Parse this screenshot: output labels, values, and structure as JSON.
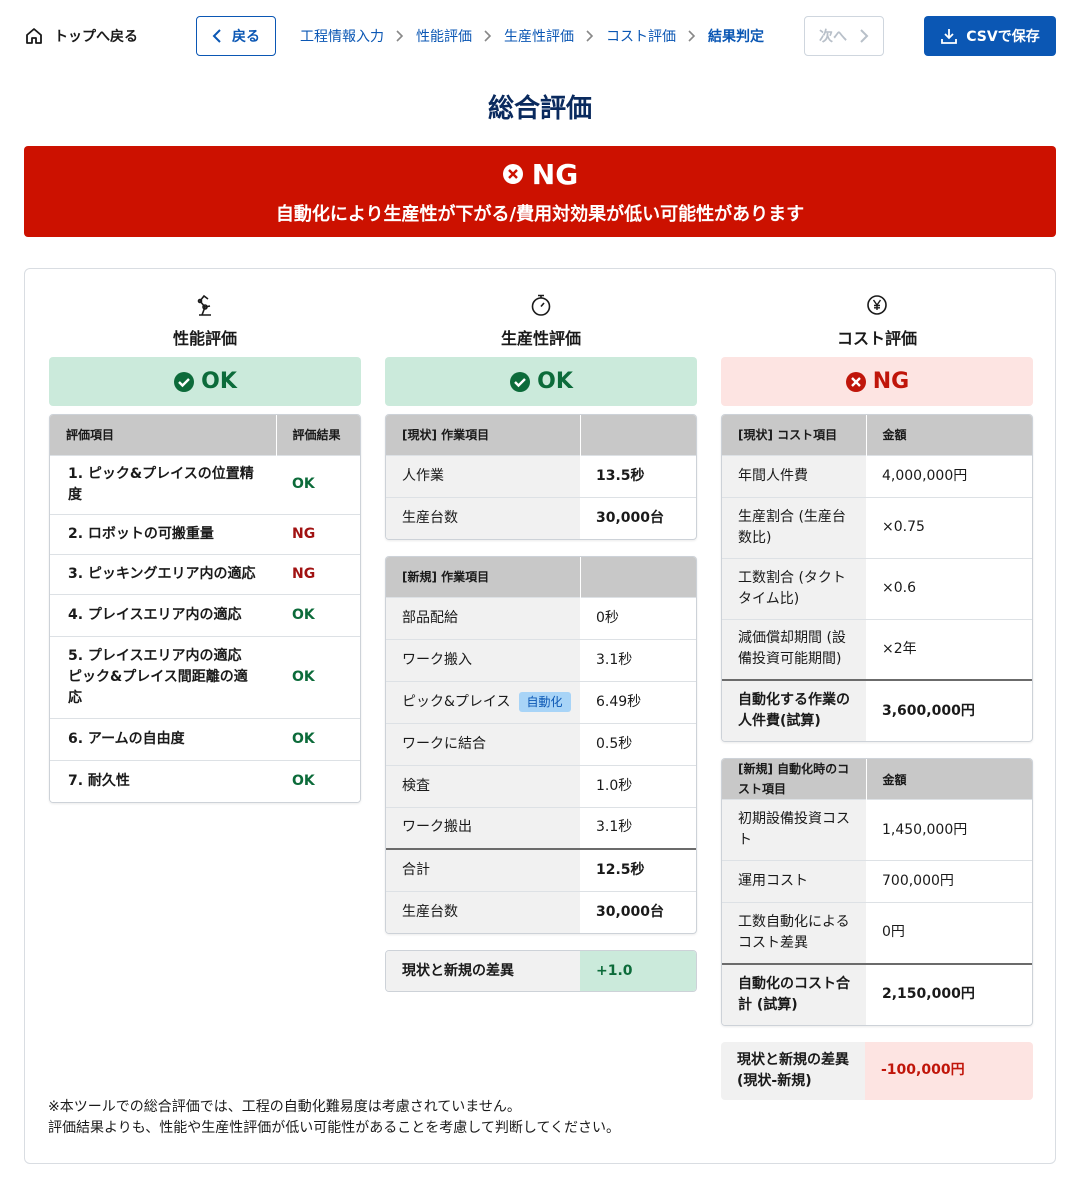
{
  "header": {
    "home_label": "トップへ戻る",
    "back_label": "戻る",
    "next_label": "次へ",
    "csv_label": "CSVで保存",
    "breadcrumbs": [
      "工程情報入力",
      "性能評価",
      "生産性評価",
      "コスト評価",
      "結果判定"
    ]
  },
  "page_title": "総合評価",
  "overall": {
    "status": "NG",
    "message": "自動化により生産性が下がる/費用対効果が低い可能性があります",
    "color": "#cc1100"
  },
  "performance": {
    "title": "性能評価",
    "icon": "robot-arm-icon",
    "result": "OK",
    "headers": [
      "評価項目",
      "評価結果"
    ],
    "rows": [
      {
        "item": "1. ピック&プレイスの位置精度",
        "result": "OK"
      },
      {
        "item": "2. ロボットの可搬重量",
        "result": "NG"
      },
      {
        "item": "3. ピッキングエリア内の適応",
        "result": "NG"
      },
      {
        "item": "4. プレイスエリア内の適応",
        "result": "OK"
      },
      {
        "item": "5. プレイスエリア内の適応 ピック&プレイス間距離の適応",
        "result": "OK"
      },
      {
        "item": "6. アームの自由度",
        "result": "OK"
      },
      {
        "item": "7. 耐久性",
        "result": "OK"
      }
    ]
  },
  "productivity": {
    "title": "生産性評価",
    "icon": "stopwatch-icon",
    "result": "OK",
    "current": {
      "header": "[現状] 作業項目",
      "rows": [
        {
          "label": "人作業",
          "value": "13.5秒"
        },
        {
          "label": "生産台数",
          "value": "30,000台"
        }
      ]
    },
    "new": {
      "header": "[新規] 作業項目",
      "tag": "自動化",
      "rows": [
        {
          "label": "部品配給",
          "value": "0秒"
        },
        {
          "label": "ワーク搬入",
          "value": "3.1秒"
        },
        {
          "label": "ピック&プレイス",
          "value": "6.49秒"
        },
        {
          "label": "ワークに結合",
          "value": "0.5秒"
        },
        {
          "label": "検査",
          "value": "1.0秒"
        },
        {
          "label": "ワーク搬出",
          "value": "3.1秒"
        }
      ],
      "total_label": "合計",
      "total_value": "12.5秒",
      "units_label": "生産台数",
      "units_value": "30,000台"
    },
    "diff": {
      "label": "現状と新規の差異",
      "value": "+1.0"
    }
  },
  "cost": {
    "title": "コスト評価",
    "icon": "yen-icon",
    "result": "NG",
    "current": {
      "header": "[現状] コスト項目",
      "value_header": "金額",
      "rows": [
        {
          "label": "年間人件費",
          "value": "4,000,000円"
        },
        {
          "label": "生産割合 (生産台数比)",
          "value": "×0.75"
        },
        {
          "label": "工数割合 (タクトタイム比)",
          "value": "×0.6"
        },
        {
          "label": "減価償却期間 (設備投資可能期間)",
          "value": "×2年"
        }
      ],
      "total_label": "自動化する作業の人件費(試算)",
      "total_value": "3,600,000円"
    },
    "new": {
      "header": "[新規] 自動化時のコスト項目",
      "value_header": "金額",
      "rows": [
        {
          "label": "初期設備投資コスト",
          "value": "1,450,000円"
        },
        {
          "label": "運用コスト",
          "value": "700,000円"
        },
        {
          "label": "工数自動化によるコスト差異",
          "value": "0円"
        }
      ],
      "total_label": "自動化のコスト合計 (試算)",
      "total_value": "2,150,000円"
    },
    "diff": {
      "label": "現状と新規の差異(現状-新規)",
      "value": "-100,000円"
    }
  },
  "footnote": [
    "※本ツールでの総合評価では、工程の自動化難易度は考慮されていません。",
    "評価結果よりも、性能や生産性評価が低い可能性があることを考慮して判断してください。"
  ]
}
